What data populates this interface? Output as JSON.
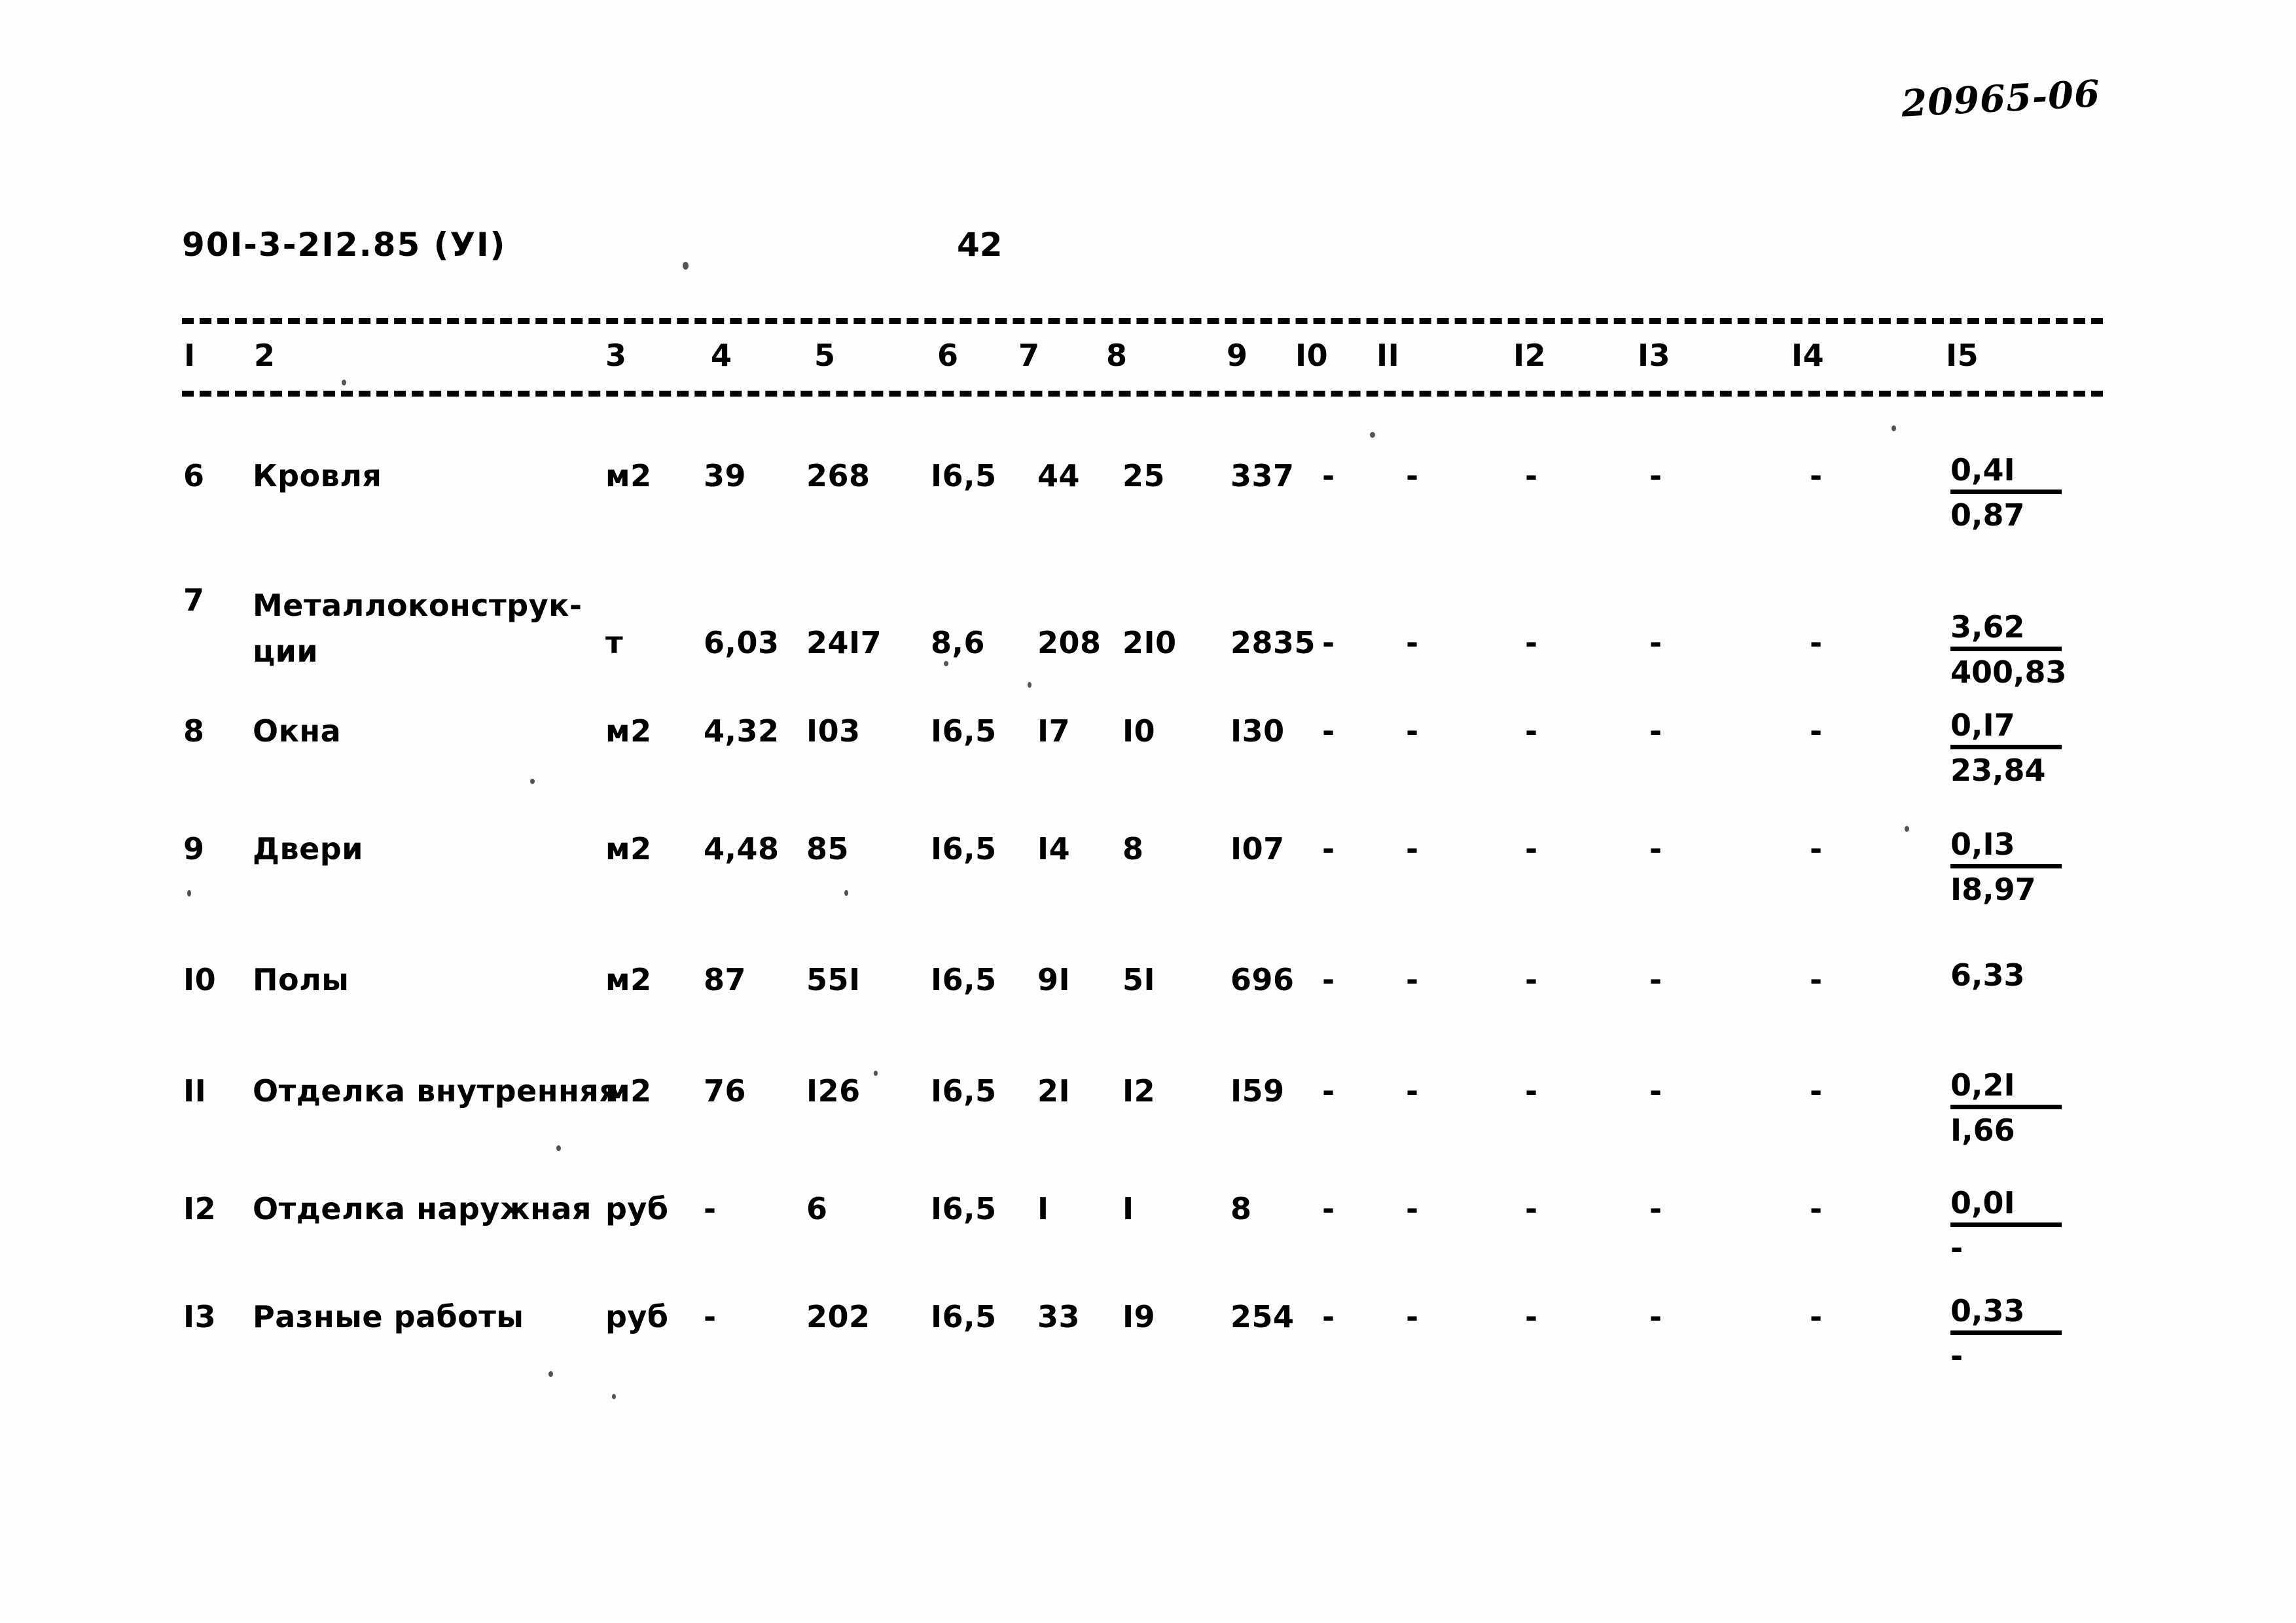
{
  "archive": {
    "code": "20965-06"
  },
  "header": {
    "doc_code": "90I-3-2I2.85  (УI)",
    "page_number": "42"
  },
  "table": {
    "column_headers": [
      "I",
      "2",
      "3",
      "4",
      "5",
      "6",
      "7",
      "8",
      "9",
      "I0",
      "II",
      "I2",
      "I3",
      "I4",
      "I5"
    ],
    "dash_symbol": "-",
    "rows": [
      {
        "num": "6",
        "name": "Кровля",
        "name_line2": "",
        "unit": "м2",
        "c4": "39",
        "c5": "268",
        "c6": "I6,5",
        "c7": "44",
        "c8": "25",
        "c9": "337",
        "c10": "-",
        "c11": "-",
        "c12": "-",
        "c13": "-",
        "c14": "-",
        "c15_num": "0,4I",
        "c15_den": "0,87"
      },
      {
        "num": "7",
        "name": "Металлоконструк-",
        "name_line2": "ции",
        "unit": "т",
        "c4": "6,03",
        "c5": "24I7",
        "c6": "8,6",
        "c7": "208",
        "c8": "2I0",
        "c9": "2835",
        "c10": "-",
        "c11": "-",
        "c12": "-",
        "c13": "-",
        "c14": "-",
        "c15_num": "3,62",
        "c15_den": "400,83"
      },
      {
        "num": "8",
        "name": "Окна",
        "name_line2": "",
        "unit": "м2",
        "c4": "4,32",
        "c5": "I03",
        "c6": "I6,5",
        "c7": "I7",
        "c8": "I0",
        "c9": "I30",
        "c10": "-",
        "c11": "-",
        "c12": "-",
        "c13": "-",
        "c14": "-",
        "c15_num": "0,I7",
        "c15_den": "23,84"
      },
      {
        "num": "9",
        "name": "Двери",
        "name_line2": "",
        "unit": "м2",
        "c4": "4,48",
        "c5": "85",
        "c6": "I6,5",
        "c7": "I4",
        "c8": "8",
        "c9": "I07",
        "c10": "-",
        "c11": "-",
        "c12": "-",
        "c13": "-",
        "c14": "-",
        "c15_num": "0,I3",
        "c15_den": "I8,97"
      },
      {
        "num": "I0",
        "name": "Полы",
        "name_line2": "",
        "unit": "м2",
        "c4": "87",
        "c5": "55I",
        "c6": "I6,5",
        "c7": "9I",
        "c8": "5I",
        "c9": "696",
        "c10": "-",
        "c11": "-",
        "c12": "-",
        "c13": "-",
        "c14": "-",
        "c15_num": "6,33",
        "c15_den": ""
      },
      {
        "num": "II",
        "name": "Отделка внутренняя",
        "name_line2": "",
        "unit": "м2",
        "c4": "76",
        "c5": "I26",
        "c6": "I6,5",
        "c7": "2I",
        "c8": "I2",
        "c9": "I59",
        "c10": "-",
        "c11": "-",
        "c12": "-",
        "c13": "-",
        "c14": "-",
        "c15_num": "0,2I",
        "c15_den": "I,66"
      },
      {
        "num": "I2",
        "name": "Отделка наружная",
        "name_line2": "",
        "unit": "руб",
        "c4": "-",
        "c5": "6",
        "c6": "I6,5",
        "c7": "I",
        "c8": "I",
        "c9": "8",
        "c10": "-",
        "c11": "-",
        "c12": "-",
        "c13": "-",
        "c14": "-",
        "c15_num": "0,0I",
        "c15_den": "-"
      },
      {
        "num": "I3",
        "name": "Разные работы",
        "name_line2": "",
        "unit": "руб",
        "c4": "-",
        "c5": "202",
        "c6": "I6,5",
        "c7": "33",
        "c8": "I9",
        "c9": "254",
        "c10": "-",
        "c11": "-",
        "c12": "-",
        "c13": "-",
        "c14": "-",
        "c15_num": "0,33",
        "c15_den": "-"
      }
    ]
  }
}
